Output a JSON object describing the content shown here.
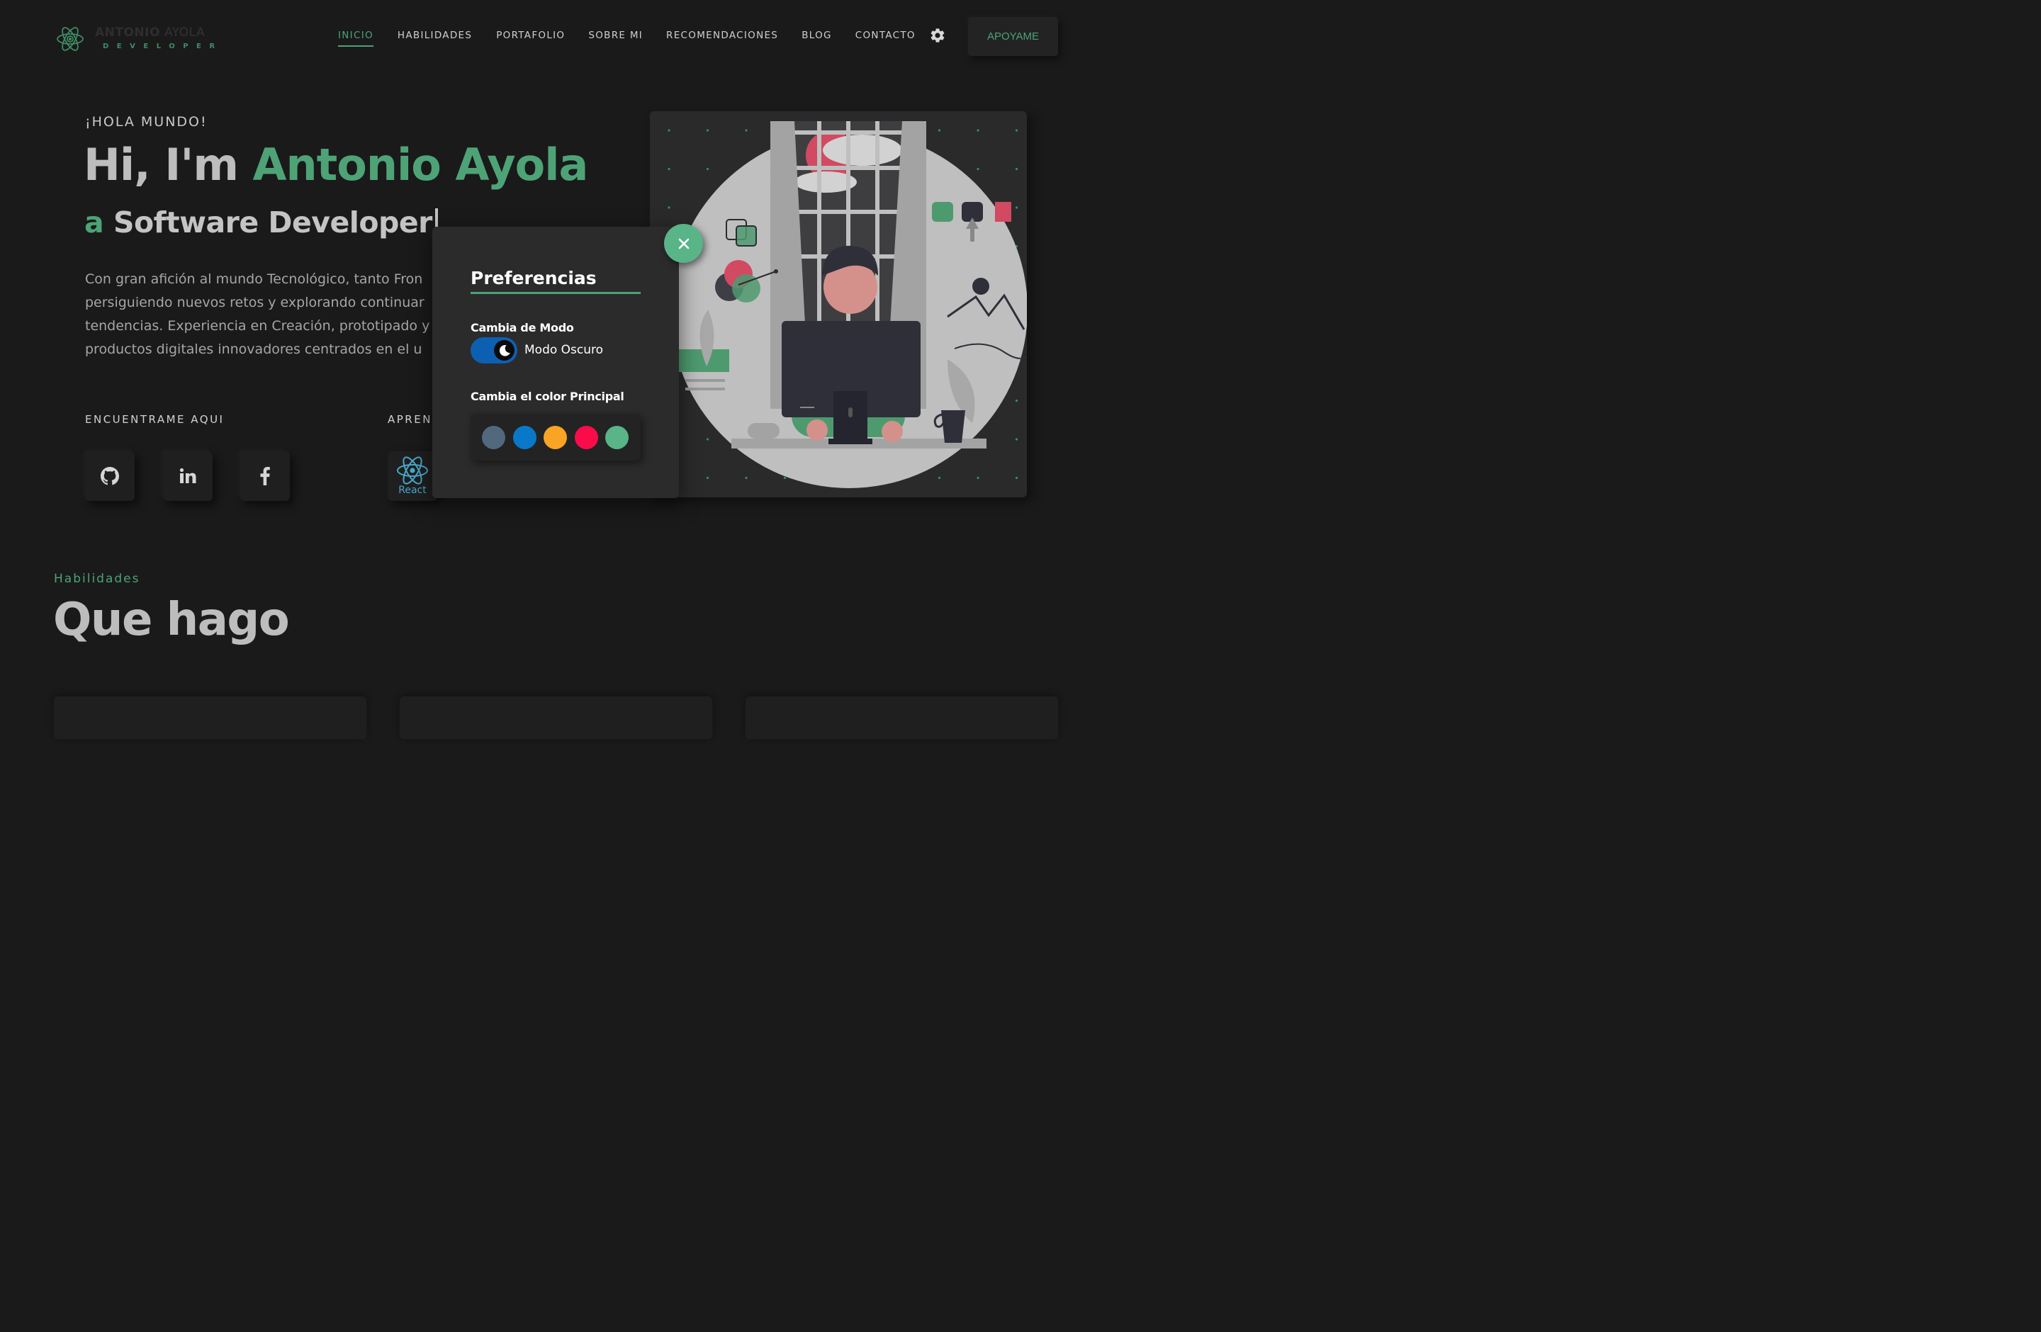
{
  "brand": {
    "first_name": "ANTONIO",
    "last_name": "AYOLA",
    "subtitle": "DEVELOPER"
  },
  "nav": {
    "items": [
      {
        "label": "INICIO",
        "active": true
      },
      {
        "label": "HABILIDADES",
        "active": false
      },
      {
        "label": "PORTAFOLIO",
        "active": false
      },
      {
        "label": "SOBRE MI",
        "active": false
      },
      {
        "label": "RECOMENDACIONES",
        "active": false
      },
      {
        "label": "BLOG",
        "active": false
      },
      {
        "label": "CONTACTO",
        "active": false
      }
    ],
    "settings_icon": "gear-icon",
    "support_button": "APOYAME"
  },
  "hero": {
    "greeting": "¡HOLA MUNDO!",
    "title_prefix": "Hi, I'm ",
    "title_name": "Antonio Ayola",
    "subtitle_prefix": "a ",
    "subtitle_role": "Software Developer",
    "description_lines": [
      "Con gran afición al mundo Tecnológico, tanto Fron",
      "persiguiendo nuevos retos y explorando continuar",
      "tendencias. Experiencia en Creación, prototipado y",
      "productos digitales innovadores centrados en el u"
    ],
    "find_me_label": "ENCUENTRAME AQUI",
    "learning_label": "APREN",
    "socials": [
      {
        "name": "github",
        "icon": "github-icon"
      },
      {
        "name": "linkedin",
        "icon": "linkedin-icon"
      },
      {
        "name": "facebook",
        "icon": "facebook-icon"
      }
    ],
    "learning_tech": {
      "label": "React",
      "icon": "react-icon"
    }
  },
  "preferences": {
    "title": "Preferencias",
    "mode_heading": "Cambia de Modo",
    "mode_value": "Modo Oscuro",
    "dark_mode_enabled": true,
    "color_heading": "Cambia el color Principal",
    "colors": [
      "#51687d",
      "#0a78c9",
      "#f9a425",
      "#fa0c4b",
      "#59b487"
    ],
    "close_icon": "close-icon"
  },
  "skills": {
    "kicker": "Habilidades",
    "title": "Que hago"
  },
  "theme": {
    "accent": "#4ea376",
    "background": "#1a1a1b"
  }
}
